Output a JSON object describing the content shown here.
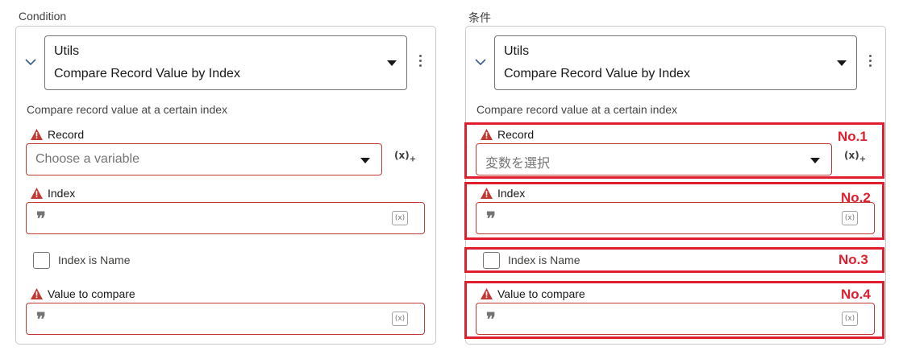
{
  "left": {
    "section_title": "Condition",
    "action_category": "Utils",
    "action_name": "Compare Record Value by Index",
    "description": "Compare record value at a certain index",
    "record_label": "Record",
    "record_placeholder": "Choose a variable",
    "index_label": "Index",
    "checkbox_label": "Index is Name",
    "value_label": "Value to compare"
  },
  "right": {
    "section_title": "条件",
    "action_category": "Utils",
    "action_name": "Compare Record Value by Index",
    "description": "Compare record value at a certain index",
    "record_label": "Record",
    "record_placeholder": "変数を選択",
    "index_label": "Index",
    "checkbox_label": "Index is Name",
    "value_label": "Value to compare",
    "annotations": [
      "No.1",
      "No.2",
      "No.3",
      "No.4"
    ]
  },
  "icons": {
    "resource_picker": "(x)",
    "quote": "❞",
    "fx": "(x)"
  },
  "colors": {
    "error_border": "#c23934",
    "annotation_red": "#e01e2e",
    "warning_icon": "#c23934"
  }
}
